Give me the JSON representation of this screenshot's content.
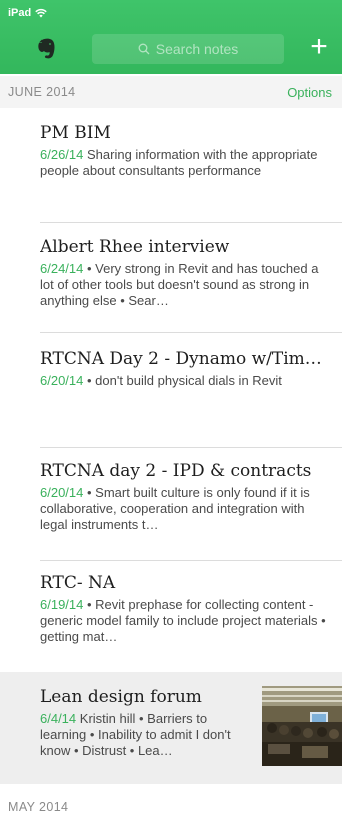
{
  "status": {
    "device": "iPad"
  },
  "header": {
    "search_placeholder": "Search notes",
    "add_label": "+"
  },
  "section": {
    "title": "JUNE 2014",
    "options_label": "Options"
  },
  "notes": [
    {
      "title": "PM BIM",
      "date": "6/26/14",
      "text": " Sharing information with the appropriate people about consultants performance"
    },
    {
      "title": "Albert Rhee interview",
      "date": "6/24/14",
      "text": " • Very strong in Revit and has touched a lot of other tools but doesn't sound as strong in anything else • Sear…"
    },
    {
      "title": "RTCNA Day 2 - Dynamo w/Tim…",
      "date": "6/20/14",
      "text": " • don't build physical dials in Revit"
    },
    {
      "title": "RTCNA day 2 - IPD & contracts",
      "date": "6/20/14",
      "text": " • Smart built culture is only found if it is collaborative, cooperation and integration with legal instruments t…"
    },
    {
      "title": "RTC- NA",
      "date": "6/19/14",
      "text": " • Revit prephase for collecting content - generic model family to include project materials • getting mat…"
    },
    {
      "title": "Lean design forum",
      "date": "6/4/14",
      "text": " Kristin hill • Barriers to learning • Inability to admit I don't know • Distrust • Lea…"
    }
  ],
  "next_section": {
    "title": "MAY 2014"
  },
  "colors": {
    "brand_green": "#36b85e",
    "date_green": "#3ab15c"
  }
}
